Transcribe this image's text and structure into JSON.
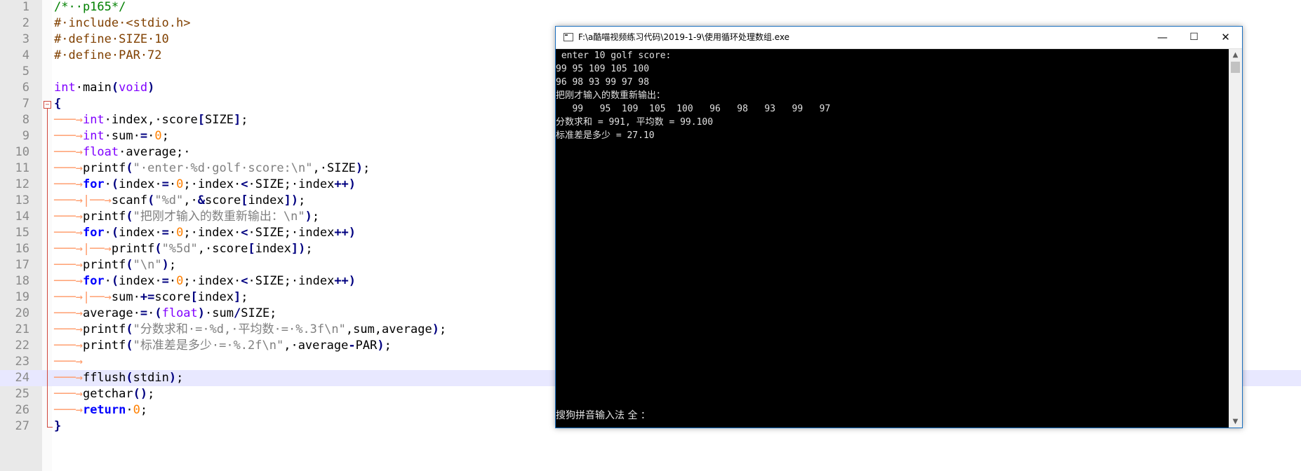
{
  "editor": {
    "current_line": 24,
    "lines": [
      {
        "n": "1",
        "html": "<span class=\"cm\">/*··p165*/</span>"
      },
      {
        "n": "2",
        "html": "<span class=\"pp\">#·include·&lt;stdio.h&gt;</span>"
      },
      {
        "n": "3",
        "html": "<span class=\"pp\">#·define·SIZE·10</span>"
      },
      {
        "n": "4",
        "html": "<span class=\"pp\">#·define·PAR·72</span>"
      },
      {
        "n": "5",
        "html": ""
      },
      {
        "n": "6",
        "html": "<span class=\"ty\">int</span>·main<span class=\"op\">(</span><span class=\"ty\">void</span><span class=\"op\">)</span>"
      },
      {
        "n": "7",
        "html": "<span class=\"op\">{</span>"
      },
      {
        "n": "8",
        "html": "<span class=\"tab-arrow\">───→</span><span class=\"ty\">int</span>·index,·score<span class=\"op\">[</span>SIZE<span class=\"op\">]</span>;"
      },
      {
        "n": "9",
        "html": "<span class=\"tab-arrow\">───→</span><span class=\"ty\">int</span>·sum·<span class=\"op\">=</span>·<span class=\"nm\">0</span>;"
      },
      {
        "n": "10",
        "html": "<span class=\"tab-arrow\">───→</span><span class=\"ty\">float</span>·average;·"
      },
      {
        "n": "11",
        "html": "<span class=\"tab-arrow\">───→</span>printf<span class=\"op\">(</span><span class=\"st\">\"·enter·%d·golf·score:\\n\"</span>,·SIZE<span class=\"op\">)</span>;"
      },
      {
        "n": "12",
        "html": "<span class=\"tab-arrow\">───→</span><span class=\"kw\">for</span>·<span class=\"op\">(</span>index·<span class=\"op\">=</span>·<span class=\"nm\">0</span>;·index·<span class=\"op\">&lt;</span>·SIZE;·index<span class=\"op\">++)</span>"
      },
      {
        "n": "13",
        "html": "<span class=\"tab-arrow\">───→|──→</span>scanf<span class=\"op\">(</span><span class=\"st\">\"%d\"</span>,·<span class=\"op\">&amp;</span>score<span class=\"op\">[</span>index<span class=\"op\">])</span>;"
      },
      {
        "n": "14",
        "html": "<span class=\"tab-arrow\">───→</span>printf<span class=\"op\">(</span><span class=\"st\">\"把刚才输入的数重新输出：\\n\"</span><span class=\"op\">)</span>;"
      },
      {
        "n": "15",
        "html": "<span class=\"tab-arrow\">───→</span><span class=\"kw\">for</span>·<span class=\"op\">(</span>index·<span class=\"op\">=</span>·<span class=\"nm\">0</span>;·index·<span class=\"op\">&lt;</span>·SIZE;·index<span class=\"op\">++)</span>"
      },
      {
        "n": "16",
        "html": "<span class=\"tab-arrow\">───→|──→</span>printf<span class=\"op\">(</span><span class=\"st\">\"%5d\"</span>,·score<span class=\"op\">[</span>index<span class=\"op\">])</span>;"
      },
      {
        "n": "17",
        "html": "<span class=\"tab-arrow\">───→</span>printf<span class=\"op\">(</span><span class=\"st\">\"\\n\"</span><span class=\"op\">)</span>;"
      },
      {
        "n": "18",
        "html": "<span class=\"tab-arrow\">───→</span><span class=\"kw\">for</span>·<span class=\"op\">(</span>index·<span class=\"op\">=</span>·<span class=\"nm\">0</span>;·index·<span class=\"op\">&lt;</span>·SIZE;·index<span class=\"op\">++)</span>"
      },
      {
        "n": "19",
        "html": "<span class=\"tab-arrow\">───→|──→</span>sum·<span class=\"op\">+=</span>score<span class=\"op\">[</span>index<span class=\"op\">]</span>;"
      },
      {
        "n": "20",
        "html": "<span class=\"tab-arrow\">───→</span>average·<span class=\"op\">=</span>·<span class=\"op\">(</span><span class=\"ty\">float</span><span class=\"op\">)</span>·sum<span class=\"op\">/</span>SIZE;"
      },
      {
        "n": "21",
        "html": "<span class=\"tab-arrow\">───→</span>printf<span class=\"op\">(</span><span class=\"st\">\"分数求和·=·%d,·平均数·=·%.3f\\n\"</span>,sum,average<span class=\"op\">)</span>;"
      },
      {
        "n": "22",
        "html": "<span class=\"tab-arrow\">───→</span>printf<span class=\"op\">(</span><span class=\"st\">\"标准差是多少·=·%.2f\\n\"</span>,·average<span class=\"op\">-</span>PAR<span class=\"op\">)</span>;"
      },
      {
        "n": "23",
        "html": "<span class=\"tab-arrow\">───→</span>"
      },
      {
        "n": "24",
        "html": "<span class=\"tab-arrow\">───→</span>fflush<span class=\"op\">(</span>stdin<span class=\"op\">)</span>;"
      },
      {
        "n": "25",
        "html": "<span class=\"tab-arrow\">───→</span>getchar<span class=\"op\">()</span>;"
      },
      {
        "n": "26",
        "html": "<span class=\"tab-arrow\">───→</span><span class=\"kw\">return</span>·<span class=\"nm\">0</span>;"
      },
      {
        "n": "27",
        "html": "<span class=\"op\">}</span>"
      }
    ]
  },
  "console": {
    "title": "F:\\a酷喵视频练习代码\\2019-1-9\\使用循环处理数组.exe",
    "minimize": "—",
    "maximize": "☐",
    "close": "✕",
    "output": [
      " enter 10 golf score:",
      "99 95 109 105 100",
      "96 98 93 99 97 98",
      "把刚才输入的数重新输出：",
      "   99   95  109  105  100   96   98   93   99   97",
      "分数求和 = 991, 平均数 = 99.100",
      "标准差是多少 = 27.10"
    ],
    "ime_status": "搜狗拼音输入法 全 ："
  }
}
